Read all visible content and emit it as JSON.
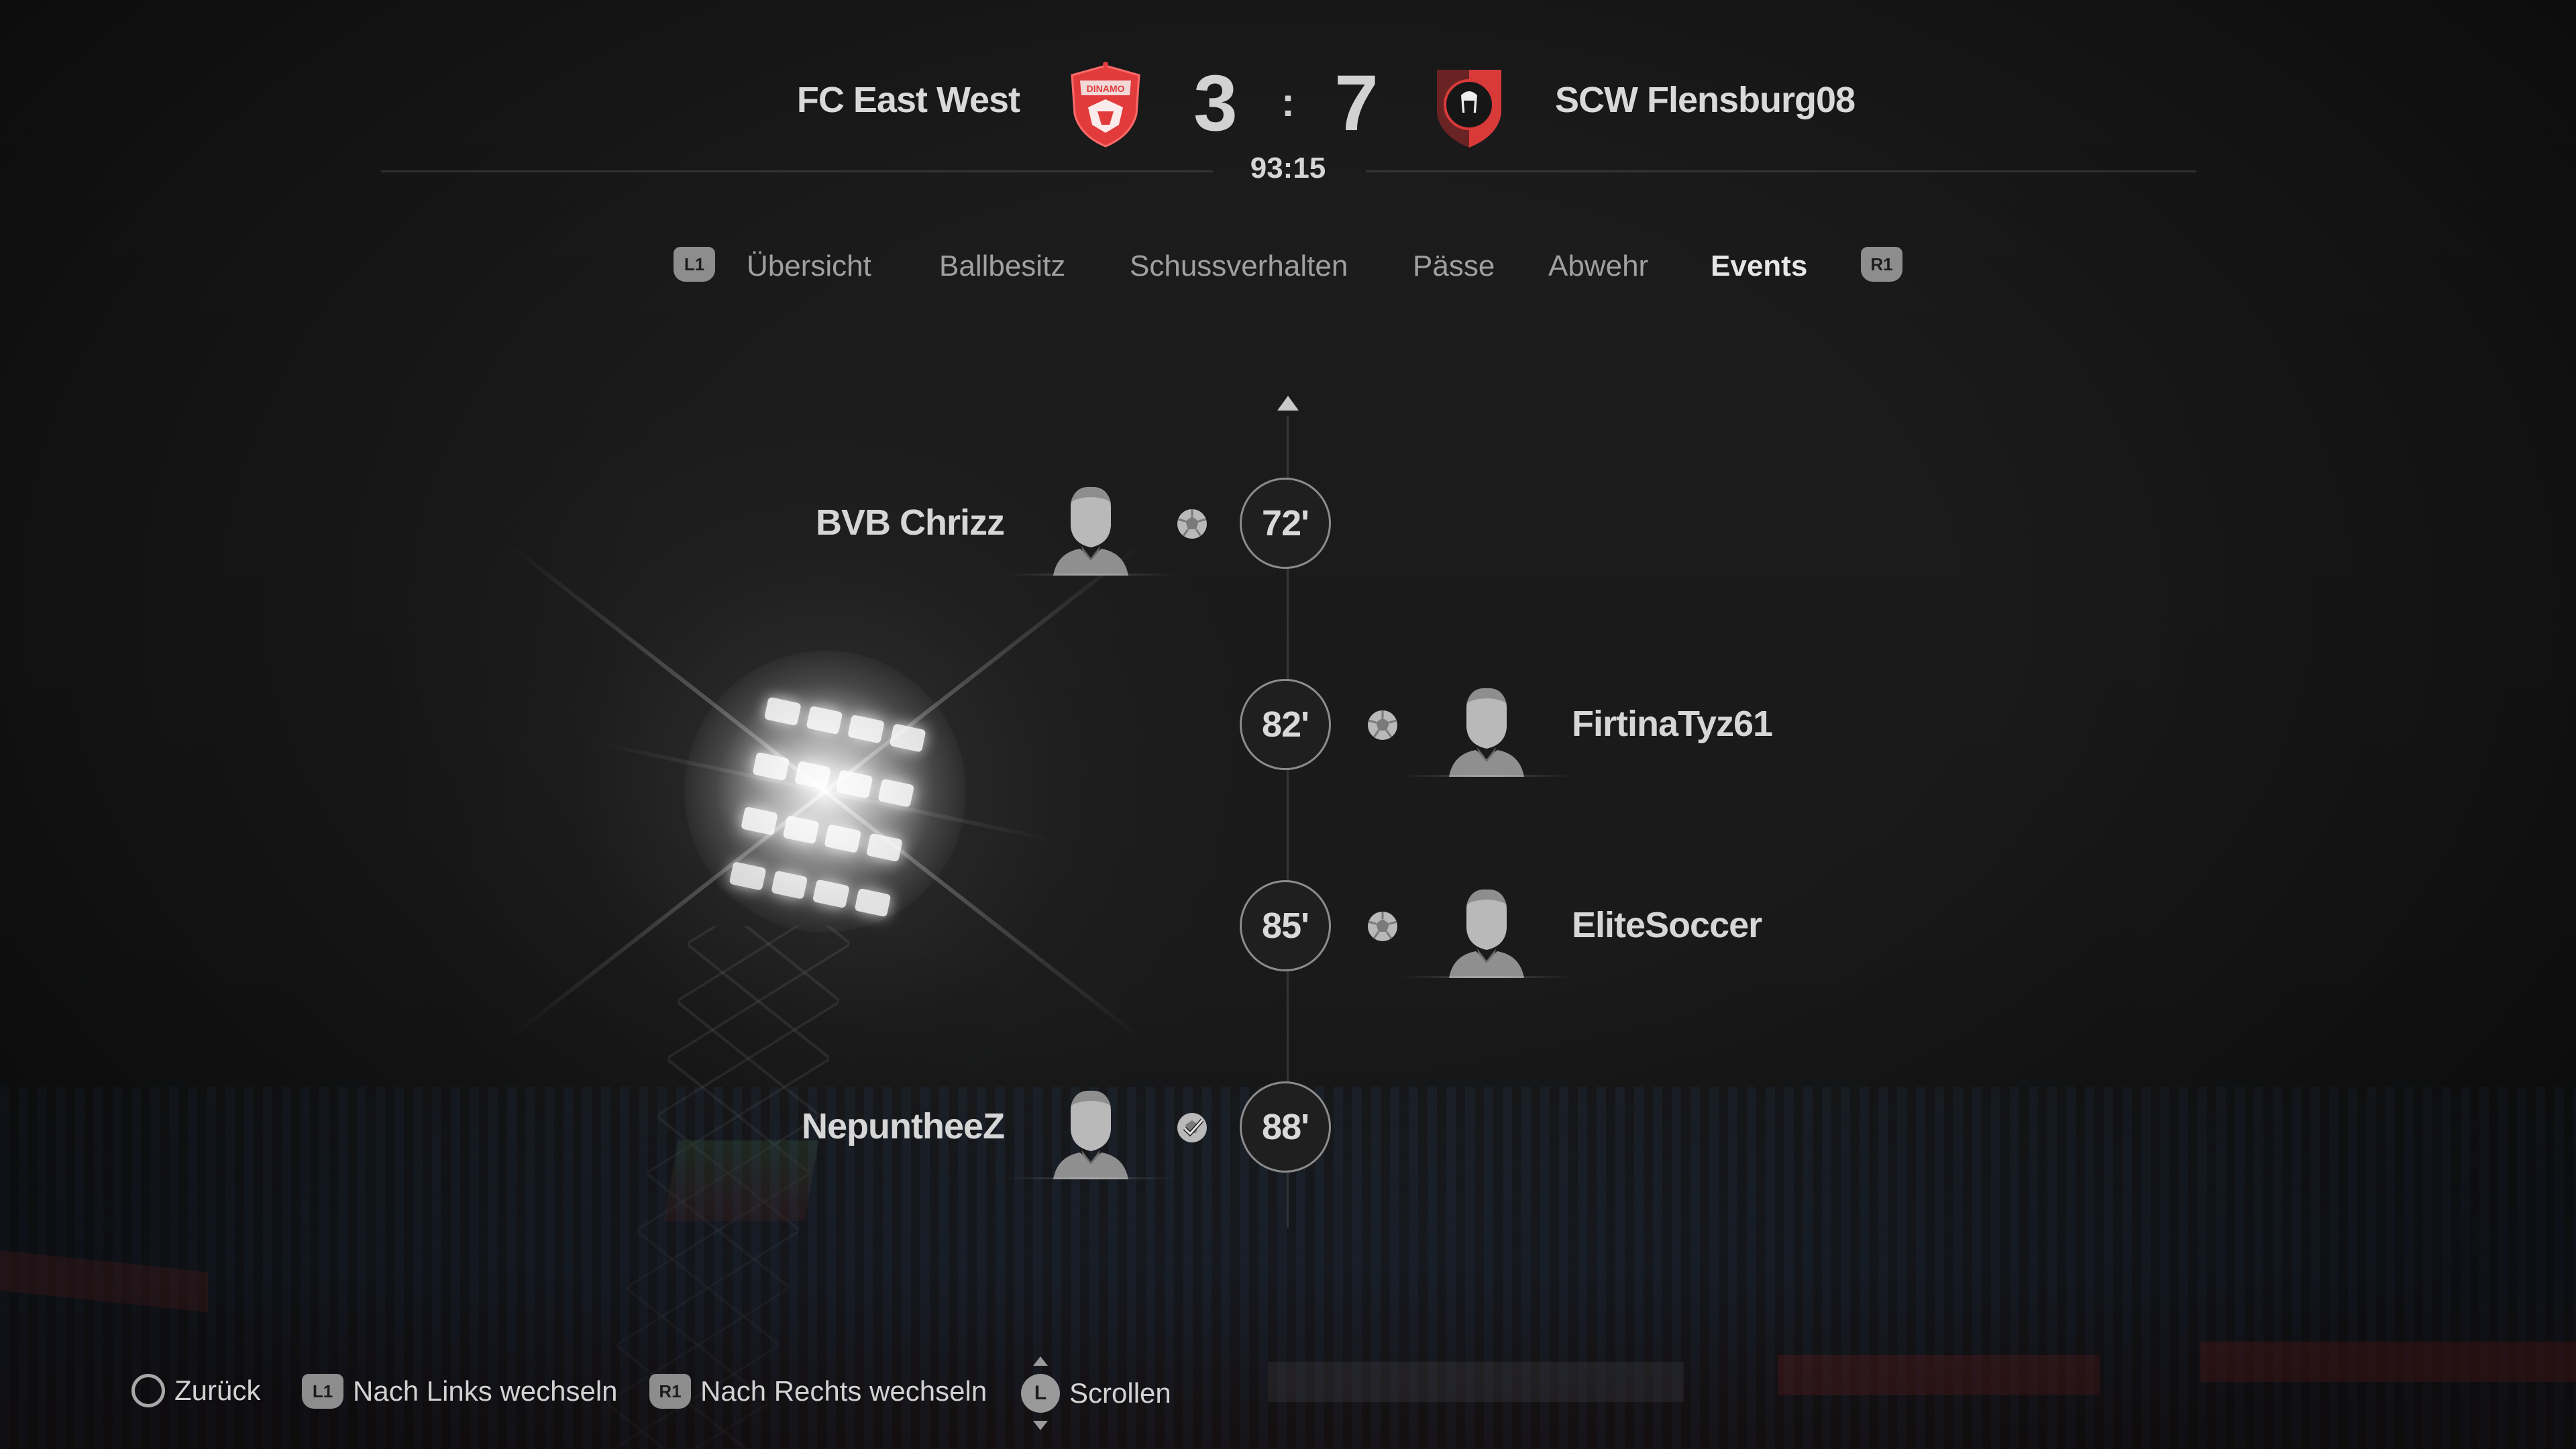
{
  "match": {
    "home_team": "FC East West",
    "away_team": "SCW Flensburg08",
    "home_score": "3",
    "away_score": "7",
    "separator": ":",
    "clock": "93:15",
    "home_crest": "shield-crest-red",
    "away_crest": "shield-crest-red-black"
  },
  "tabs": {
    "left_button": "L1",
    "right_button": "R1",
    "items": [
      {
        "label": "Übersicht",
        "active": false
      },
      {
        "label": "Ballbesitz",
        "active": false
      },
      {
        "label": "Schussverhalten",
        "active": false
      },
      {
        "label": "Pässe",
        "active": false
      },
      {
        "label": "Abwehr",
        "active": false
      },
      {
        "label": "Events",
        "active": true
      }
    ]
  },
  "events": [
    {
      "minute": "72'",
      "side": "home",
      "player": "BVB Chrizz",
      "icon": "ball-icon"
    },
    {
      "minute": "82'",
      "side": "away",
      "player": "FirtinaTyz61",
      "icon": "ball-icon"
    },
    {
      "minute": "85'",
      "side": "away",
      "player": "EliteSoccer",
      "icon": "ball-icon"
    },
    {
      "minute": "88'",
      "side": "home",
      "player": "NepuntheeZ",
      "icon": "ball-check-icon"
    }
  ],
  "footer": {
    "back": {
      "button": "circle-button",
      "label": "Zurück"
    },
    "left": {
      "button": "L1",
      "label": "Nach Links wechseln"
    },
    "right": {
      "button": "R1",
      "label": "Nach Rechts wechseln"
    },
    "scroll": {
      "button": "L",
      "label": "Scrollen"
    }
  },
  "colors": {
    "background": "#1b1b1b",
    "text": "#d9d9d9",
    "tab_inactive": "#a0a0a0",
    "crest_red": "#e23b3b"
  }
}
